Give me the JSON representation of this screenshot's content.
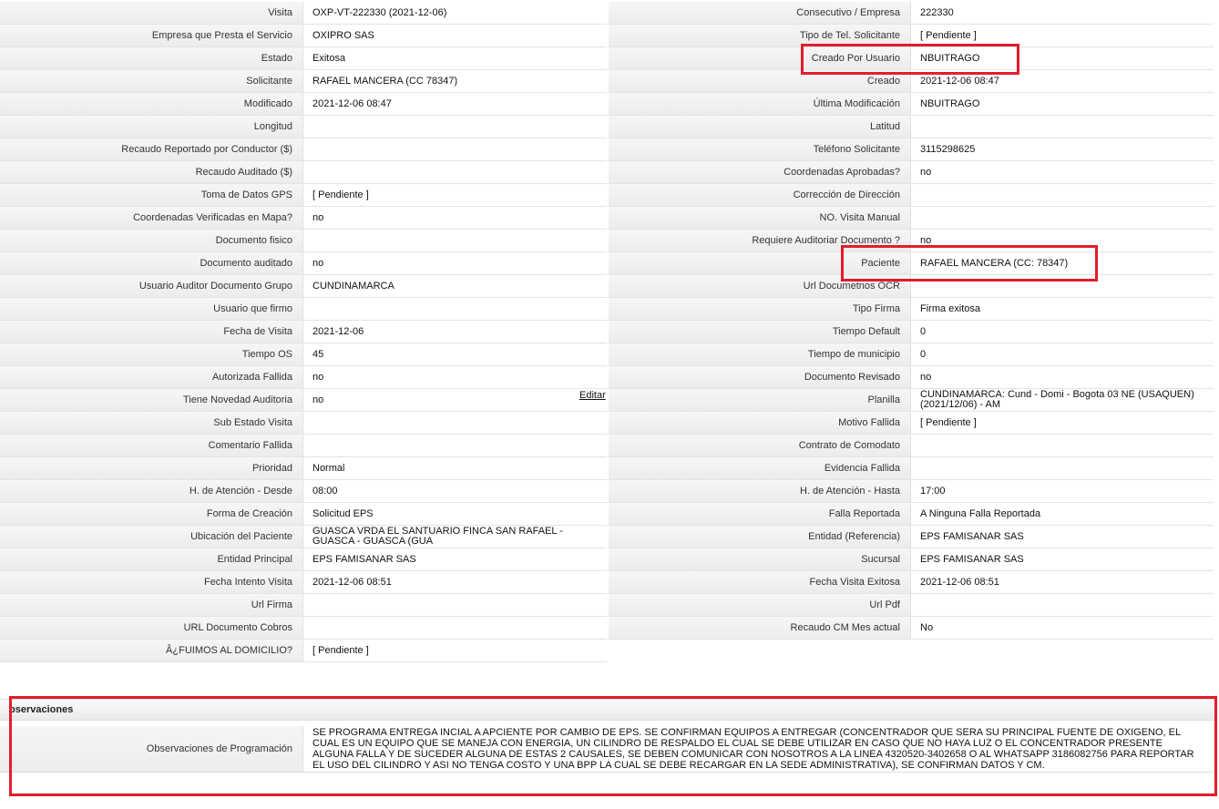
{
  "left": [
    {
      "label": "Visita",
      "value": "OXP-VT-222330 (2021-12-06)"
    },
    {
      "label": "Empresa que Presta el Servicio",
      "value": "OXIPRO SAS"
    },
    {
      "label": "Estado",
      "value": "Exitosa"
    },
    {
      "label": "Solicitante",
      "value": "RAFAEL MANCERA (CC 78347)"
    },
    {
      "label": "Modificado",
      "value": "2021-12-06 08:47"
    },
    {
      "label": "Longitud",
      "value": ""
    },
    {
      "label": "Recaudo Reportado por Conductor ($)",
      "value": ""
    },
    {
      "label": "Recaudo Auditado ($)",
      "value": ""
    },
    {
      "label": "Toma de Datos GPS",
      "value": "[ Pendiente ]"
    },
    {
      "label": "Coordenadas Verificadas en Mapa?",
      "value": " no"
    },
    {
      "label": "Documento fisico",
      "value": ""
    },
    {
      "label": "Documento auditado",
      "value": " no"
    },
    {
      "label": "Usuario Auditor Documento Grupo",
      "value": "CUNDINAMARCA"
    },
    {
      "label": "Usuario que firmo",
      "value": ""
    },
    {
      "label": "Fecha de Visita",
      "value": " 2021-12-06"
    },
    {
      "label": "Tiempo OS",
      "value": "45"
    },
    {
      "label": "Autorizada Fallida",
      "value": " no"
    },
    {
      "label": "Tiene Novedad Auditoria",
      "value": " no"
    },
    {
      "label": "Sub Estado Visita",
      "value": ""
    },
    {
      "label": "Comentario Fallida",
      "value": ""
    },
    {
      "label": "Prioridad",
      "value": "Normal"
    },
    {
      "label": "H. de Atención - Desde",
      "value": "08:00"
    },
    {
      "label": "Forma de Creación",
      "value": "Solicitud EPS"
    },
    {
      "label": "Ubicación del Paciente",
      "value": "GUASCA VRDA EL SANTUARIO FINCA SAN RAFAEL - GUASCA - GUASCA (GUA"
    },
    {
      "label": "Entidad Principal",
      "value": "EPS FAMISANAR SAS"
    },
    {
      "label": "Fecha Intento Visita",
      "value": " 2021-12-06 08:51"
    },
    {
      "label": "Url Firma",
      "value": ""
    },
    {
      "label": "URL Documento Cobros",
      "value": ""
    },
    {
      "label": "Â¿FUIMOS AL DOMICILIO?",
      "value": "[ Pendiente ]"
    }
  ],
  "right": [
    {
      "label": "Consecutivo / Empresa",
      "value": "222330"
    },
    {
      "label": "Tipo de Tel. Solicitante",
      "value": "[ Pendiente ]"
    },
    {
      "label": "Creado Por Usuario",
      "value": "NBUITRAGO"
    },
    {
      "label": "Creado",
      "value": "2021-12-06 08:47"
    },
    {
      "label": "Última Modificación",
      "value": " NBUITRAGO"
    },
    {
      "label": "Latitud",
      "value": ""
    },
    {
      "label": "Teléfono Solicitante",
      "value": "3115298625"
    },
    {
      "label": "Coordenadas Aprobadas?",
      "value": " no"
    },
    {
      "label": "Corrección de Dirección",
      "value": ""
    },
    {
      "label": "NO. Visita Manual",
      "value": ""
    },
    {
      "label": "Requiere Auditoriar Documento ?",
      "value": " no"
    },
    {
      "label": "Paciente",
      "value": "RAFAEL MANCERA (CC: 78347)"
    },
    {
      "label": "Url Documetnos OCR",
      "value": ""
    },
    {
      "label": "Tipo Firma",
      "value": "Firma exitosa"
    },
    {
      "label": "Tiempo Default",
      "value": "0"
    },
    {
      "label": "Tiempo de municipio",
      "value": "0"
    },
    {
      "label": "Documento Revisado",
      "value": " no"
    },
    {
      "label": "Planilla",
      "value": "CUNDINAMARCA: Cund - Domi - Bogota 03 NE (USAQUEN) (2021/12/06) - AM"
    },
    {
      "label": "Motivo Fallida",
      "value": "[ Pendiente ]"
    },
    {
      "label": "Contrato de Comodato",
      "value": ""
    },
    {
      "label": "Evidencia Fallida",
      "value": ""
    },
    {
      "label": "H. de Atención - Hasta",
      "value": "17:00"
    },
    {
      "label": "Falla Reportada",
      "value": "A Ninguna Falla Reportada"
    },
    {
      "label": "Entidad (Referencia)",
      "value": "EPS FAMISANAR SAS"
    },
    {
      "label": "Sucursal",
      "value": "EPS FAMISANAR SAS"
    },
    {
      "label": "Fecha Visita Exitosa",
      "value": " 2021-12-06 08:51"
    },
    {
      "label": "Url Pdf",
      "value": ""
    },
    {
      "label": "Recaudo CM Mes actual",
      "value": "No"
    }
  ],
  "edit_link": "Editar",
  "observations": {
    "header": "bservaciones",
    "label": "Observaciones de Programación",
    "text": "  SE PROGRAMA ENTREGA INCIAL A APCIENTE POR CAMBIO DE EPS. SE CONFIRMAN EQUIPOS A ENTREGAR (CONCENTRADOR QUE SERA SU PRINCIPAL FUENTE DE OXIGENO, EL CUAL ES UN EQUIPO QUE SE MANEJA CON ENERGIA, UN CILINDRO DE RESPALDO EL CUAL SE DEBE UTILIZAR EN CASO QUE NO HAYA LUZ O EL CONCENTRADOR PRESENTE ALGUNA FALLA Y DE SUCEDER ALGUNA DE ESTAS 2 CAUSALES, SE DEBEN COMUNICAR CON NOSOTROS A LA LINEA 4320520-3402658 O AL WHATSAPP 3186082756 PARA REPORTAR EL USO DEL CILINDRO Y ASI NO TENGA COSTO Y UNA BPP LA CUAL SE DEBE RECARGAR EN LA SEDE ADMINISTRATIVA), SE CONFIRMAN DATOS Y CM."
  },
  "colors": {
    "highlight": "#e21d2a",
    "label_bg": "#efefef",
    "border": "#e4e4e4"
  }
}
